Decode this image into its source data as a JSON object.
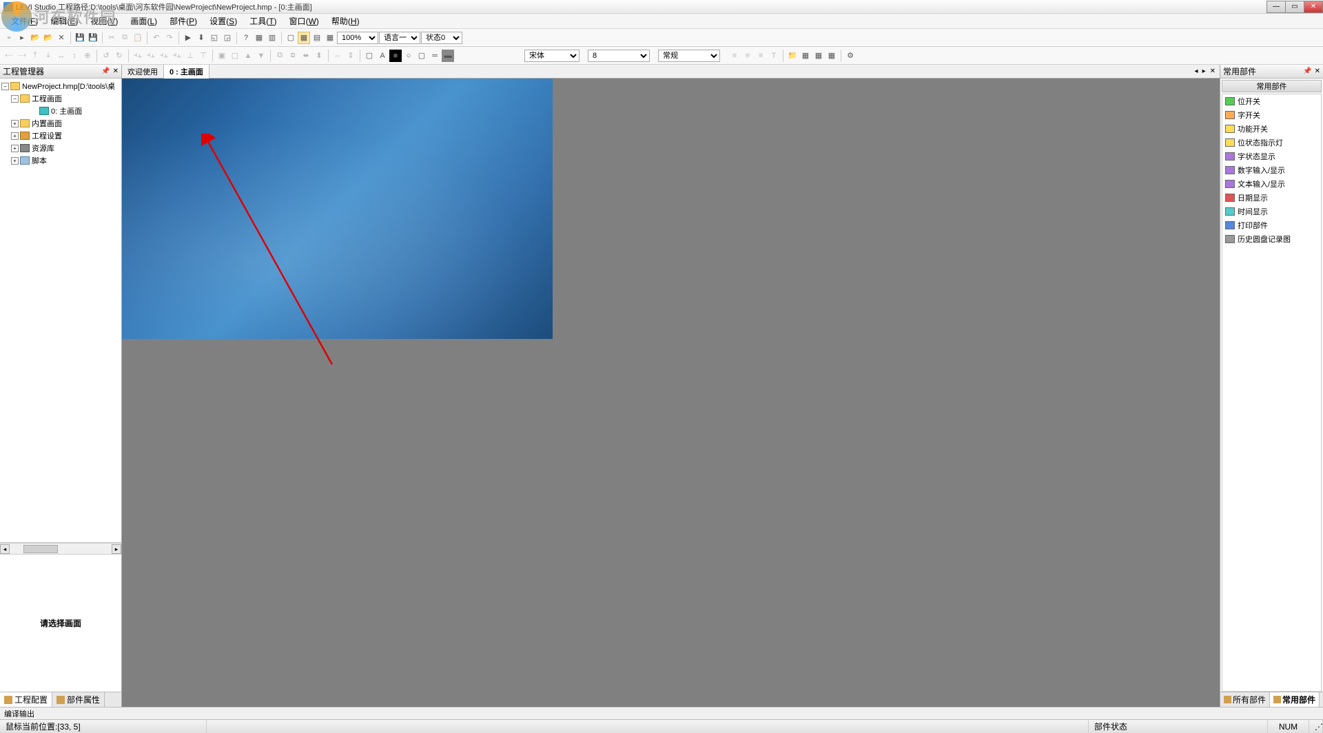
{
  "title": "LEVI Studio   工程路径:D:\\tools\\桌面\\河东软件园\\NewProject\\NewProject.hmp   - [0:主画面]",
  "watermark": "河东软件园",
  "menus": [
    {
      "label": "文件",
      "key": "F"
    },
    {
      "label": "编辑",
      "key": "E"
    },
    {
      "label": "视图",
      "key": "V"
    },
    {
      "label": "画面",
      "key": "L"
    },
    {
      "label": "部件",
      "key": "P"
    },
    {
      "label": "设置",
      "key": "S"
    },
    {
      "label": "工具",
      "key": "T"
    },
    {
      "label": "窗口",
      "key": "W"
    },
    {
      "label": "帮助",
      "key": "H"
    }
  ],
  "toolbar1": {
    "zoom": "100%",
    "language": "语言一",
    "state": "状态0"
  },
  "toolbar2": {
    "font": "宋体",
    "fontsize": "8",
    "weight": "常规"
  },
  "leftPanel": {
    "title": "工程管理器",
    "tree": {
      "root": "NewProject.hmp[D:\\tools\\桌",
      "n1": "工程画面",
      "n1a": "0: 主画面",
      "n2": "内置画面",
      "n3": "工程设置",
      "n4": "资源库",
      "n5": "脚本"
    },
    "preview": "请选择画面",
    "tabs": {
      "config": "工程配置",
      "props": "部件属性"
    }
  },
  "centerTabs": {
    "welcome": "欢迎使用",
    "main": "0 : 主画面"
  },
  "rightPanel": {
    "title": "常用部件",
    "group": "常用部件",
    "items": [
      {
        "icon": "wi-green",
        "label": "位开关"
      },
      {
        "icon": "wi-orange",
        "label": "字开关"
      },
      {
        "icon": "wi-yellow",
        "label": "功能开关"
      },
      {
        "icon": "wi-yellow",
        "label": "位状态指示灯"
      },
      {
        "icon": "wi-purple",
        "label": "字状态显示"
      },
      {
        "icon": "wi-purple",
        "label": "数字输入/显示"
      },
      {
        "icon": "wi-purple",
        "label": "文本输入/显示"
      },
      {
        "icon": "wi-red",
        "label": "日期显示"
      },
      {
        "icon": "wi-teal",
        "label": "时间显示"
      },
      {
        "icon": "wi-blue",
        "label": "打印部件"
      },
      {
        "icon": "wi-gray",
        "label": "历史圆盘记录图"
      }
    ],
    "tabs": {
      "all": "所有部件",
      "common": "常用部件"
    }
  },
  "bottomBar": "编译输出",
  "status": {
    "mouse": "鼠标当前位置:[33, 5]",
    "part": "部件状态",
    "num": "NUM"
  }
}
